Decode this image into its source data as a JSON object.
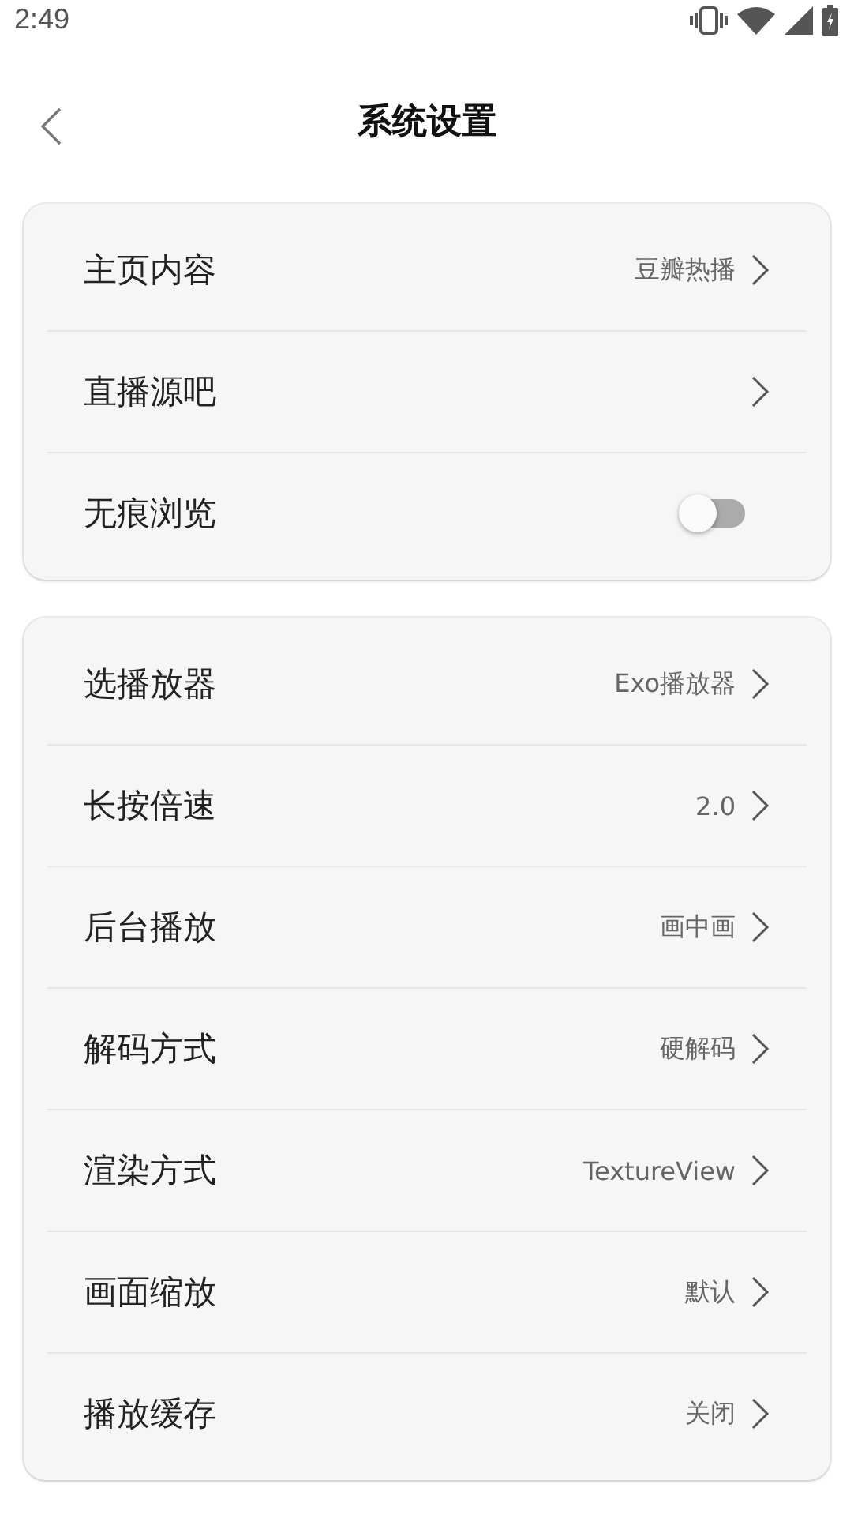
{
  "status_bar": {
    "time": "2:49"
  },
  "header": {
    "title": "系统设置"
  },
  "groups": [
    {
      "rows": [
        {
          "kind": "link",
          "label": "主页内容",
          "value": "豆瓣热播"
        },
        {
          "kind": "link",
          "label": "直播源吧"
        },
        {
          "kind": "toggle",
          "label": "无痕浏览",
          "on": false
        }
      ]
    },
    {
      "rows": [
        {
          "kind": "link",
          "label": "选播放器",
          "value": "Exo播放器"
        },
        {
          "kind": "link",
          "label": "长按倍速",
          "value": "2.0"
        },
        {
          "kind": "link",
          "label": "后台播放",
          "value": "画中画"
        },
        {
          "kind": "link",
          "label": "解码方式",
          "value": "硬解码"
        },
        {
          "kind": "link",
          "label": "渲染方式",
          "value": "TextureView"
        },
        {
          "kind": "link",
          "label": "画面缩放",
          "value": "默认"
        },
        {
          "kind": "link",
          "label": "播放缓存",
          "value": "关闭"
        }
      ]
    }
  ]
}
